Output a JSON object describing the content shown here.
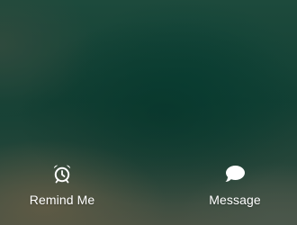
{
  "actions": [
    {
      "label": "Remind Me",
      "icon": "alarm-clock-icon"
    },
    {
      "label": "Message",
      "icon": "speech-bubble-icon"
    }
  ],
  "colors": {
    "text": "#ffffff",
    "background_primary": "#134034",
    "background_accent": "#5e5a45"
  }
}
